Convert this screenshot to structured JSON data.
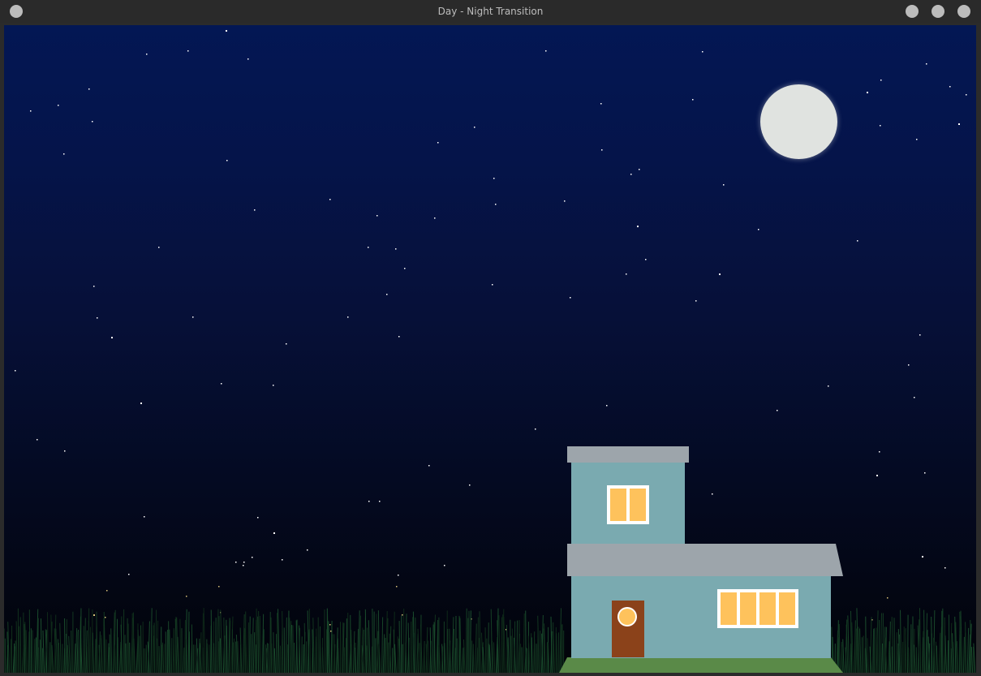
{
  "window": {
    "title": "Day - Night Transition",
    "controls": [
      "menu-button",
      "minimize-button",
      "maximize-button",
      "close-button"
    ]
  },
  "scene": {
    "sky_top_color": "#031754",
    "sky_bottom_color": "#020308",
    "moon_color": "#e0e3e0",
    "star_color": "#ffffff",
    "grass_color": "#1f4a30",
    "house": {
      "wall_color": "#7aaab0",
      "roof_color": "#9da5ab",
      "window_light_color": "#fec25c",
      "door_color": "#8b421a",
      "lawn_color": "#5a8a48",
      "upper_window_panes": 2,
      "lower_window_panes": 4
    }
  }
}
